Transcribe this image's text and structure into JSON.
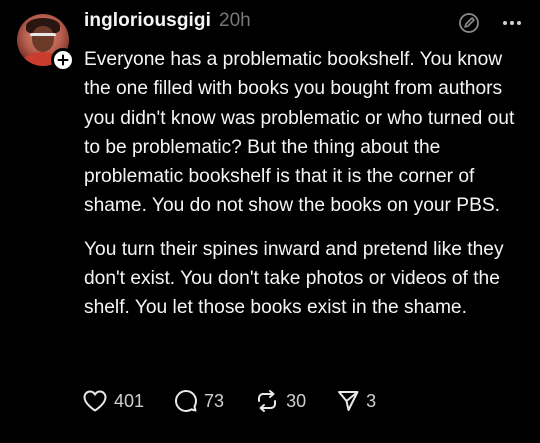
{
  "post": {
    "username": "ingloriousgigi",
    "timestamp": "20h",
    "paragraphs": [
      "Everyone has a problematic bookshelf. You know the one filled with books you bought from authors you didn't know was problematic or who turned out to be problematic?  But the thing about the problematic bookshelf is that it is the corner of shame. You do not show the books on your PBS.",
      "You turn their spines inward and pretend like they don't exist.  You don't take photos or videos of the shelf. You let those books exist in the shame."
    ],
    "stats": {
      "likes": "401",
      "replies": "73",
      "reposts": "30",
      "shares": "3"
    }
  },
  "icons": {
    "follow": "plus-icon",
    "edit": "edit-icon",
    "more": "more-icon",
    "like": "heart-icon",
    "reply": "comment-icon",
    "repost": "repost-icon",
    "share": "send-icon"
  },
  "colors": {
    "background": "#000000",
    "text": "#f3f5f7",
    "muted": "#777777"
  }
}
